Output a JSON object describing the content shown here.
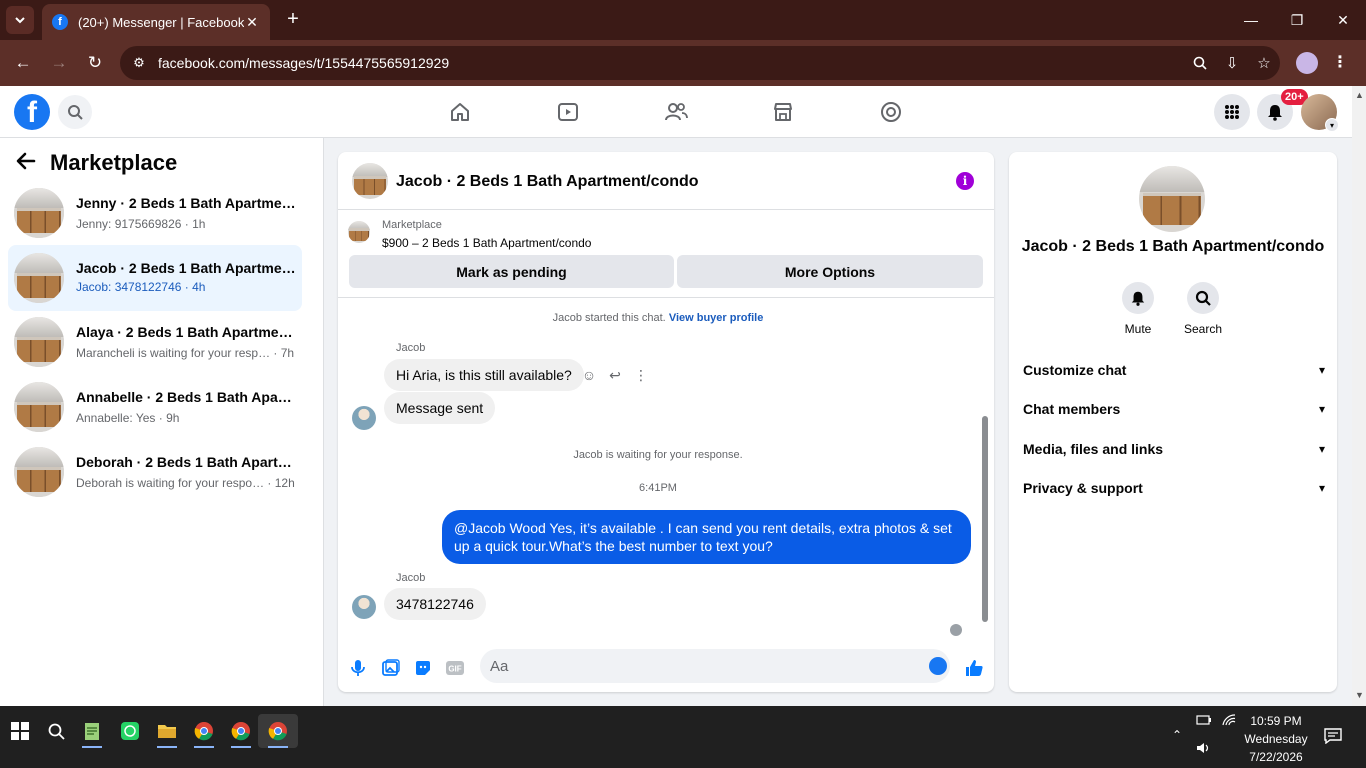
{
  "browser": {
    "tab_title": "(20+) Messenger | Facebook",
    "url": "facebook.com/messages/t/1554475565912929"
  },
  "header": {
    "notification_badge": "20+"
  },
  "sidebar": {
    "title": "Marketplace",
    "conversations": [
      {
        "name": "Jenny · 2 Beds 1 Bath Apartment…",
        "preview": "Jenny: 9175669826 · 1h",
        "active": false
      },
      {
        "name": "Jacob · 2 Beds 1 Bath Apartment…",
        "preview": "Jacob: 3478122746 · 4h",
        "active": true
      },
      {
        "name": "Alaya · 2 Beds 1 Bath Apartment…",
        "preview": "Marancheli is waiting for your resp… · 7h",
        "active": false
      },
      {
        "name": "Annabelle · 2 Beds 1 Bath Apart…",
        "preview": "Annabelle: Yes · 9h",
        "active": false
      },
      {
        "name": "Deborah · 2 Beds 1 Bath Apartm…",
        "preview": "Deborah is waiting for your respo… · 12h",
        "active": false
      }
    ]
  },
  "chat": {
    "title": "Jacob · 2 Beds 1 Bath Apartment/condo",
    "marketplace_label": "Marketplace",
    "listing": "$900 – 2 Beds 1 Bath Apartment/condo",
    "mark_pending": "Mark as pending",
    "more_options": "More Options",
    "started_text": "Jacob started this chat.",
    "view_profile": "View buyer profile",
    "sender_1": "Jacob",
    "msg_1": "Hi Aria, is this still available?",
    "msg_2": "Message sent",
    "waiting_text": "Jacob is waiting for your response.",
    "time": "6:41PM",
    "out_msg": "@Jacob Wood Yes, it’s available .  I can send you rent details, extra photos & set up a quick tour.What’s the best number to text you?",
    "sender_2": "Jacob",
    "msg_3": "3478122746",
    "input_placeholder": "Aa"
  },
  "details": {
    "name": "Jacob · 2 Beds 1 Bath Apartment/condo",
    "mute": "Mute",
    "search": "Search",
    "rows": [
      "Customize chat",
      "Chat members",
      "Media, files and links",
      "Privacy & support"
    ]
  },
  "taskbar": {
    "time": "10:59 PM",
    "day": "Wednesday",
    "date": "7/22/2026"
  },
  "colors": {
    "fb_blue": "#1877f2",
    "outgoing_bubble": "#0a5ce6",
    "info_purple": "#a000d8",
    "active_row": "#ebf5ff"
  }
}
